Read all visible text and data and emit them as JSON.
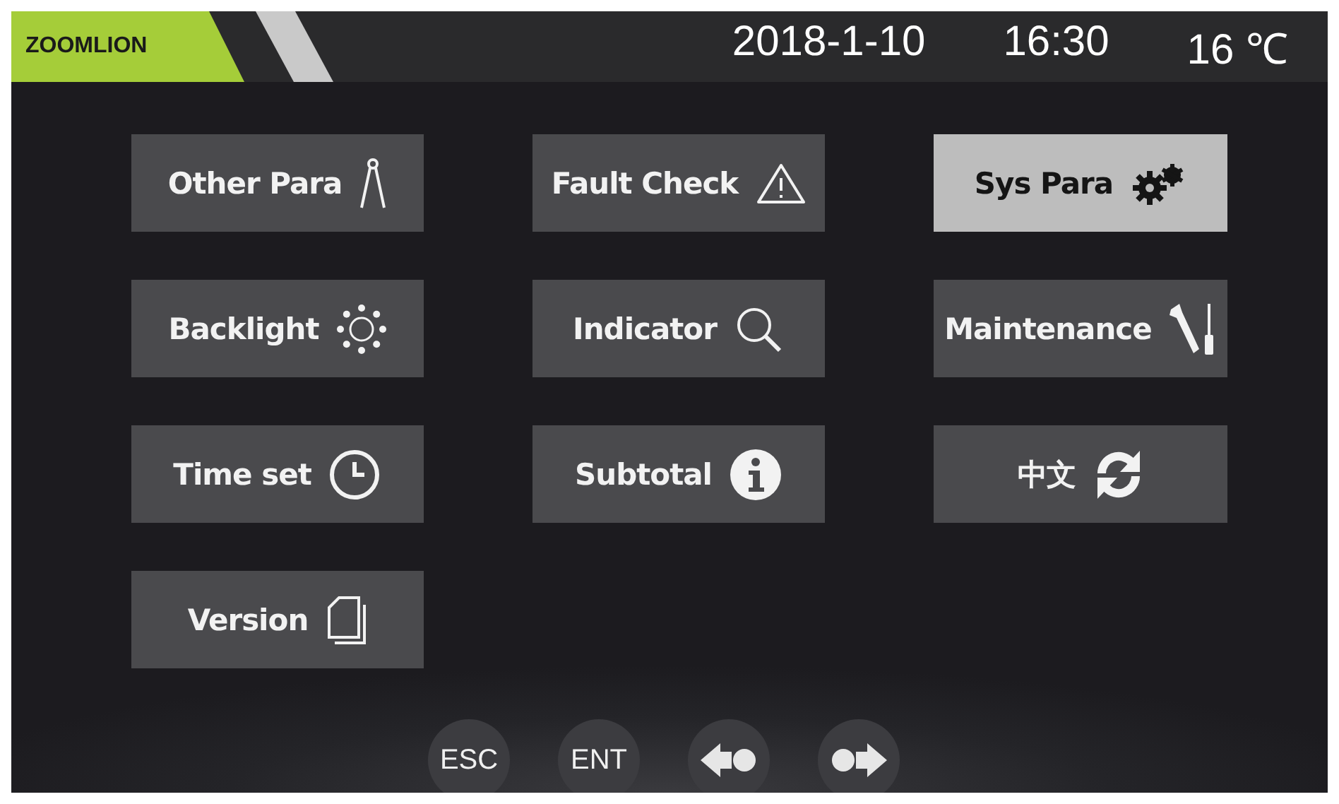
{
  "header": {
    "logo": "ZOOMLION",
    "date": "2018-1-10",
    "time": "16:30",
    "temperature": "16 ℃"
  },
  "menu": [
    {
      "label": "Other Para",
      "kind": "compass",
      "selected": false
    },
    {
      "label": "Fault Check",
      "kind": "warning",
      "selected": false
    },
    {
      "label": "Sys Para",
      "kind": "gears",
      "selected": true
    },
    {
      "label": "Backlight",
      "kind": "sun",
      "selected": false
    },
    {
      "label": "Indicator",
      "kind": "search",
      "selected": false
    },
    {
      "label": "Maintenance",
      "kind": "tools",
      "selected": false
    },
    {
      "label": "Time set",
      "kind": "clock",
      "selected": false
    },
    {
      "label": "Subtotal",
      "kind": "info",
      "selected": false
    },
    {
      "label": "中文",
      "kind": "refresh",
      "selected": false
    },
    {
      "label": "Version",
      "kind": "pages",
      "selected": false
    }
  ],
  "nav": [
    {
      "kind": "text",
      "label": "ESC"
    },
    {
      "kind": "text",
      "label": "ENT"
    },
    {
      "kind": "back"
    },
    {
      "kind": "forward"
    }
  ]
}
